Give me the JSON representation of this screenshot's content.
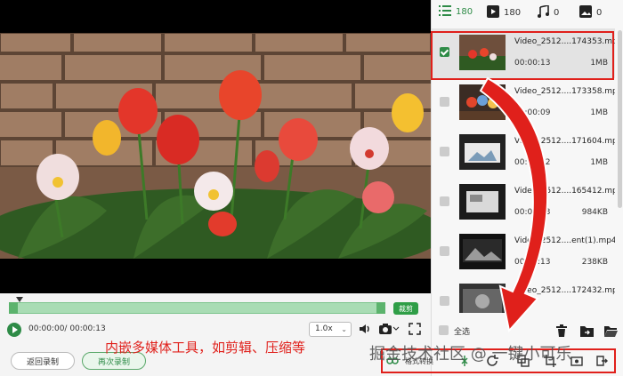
{
  "stats": {
    "all_count": "180",
    "video_count": "180",
    "audio_count": "0",
    "image_count": "0"
  },
  "player": {
    "time": "00:00:00/ 00:00:13",
    "speed": "1.0x",
    "cut_label": "裁剪"
  },
  "buttons": {
    "back": "返回录制",
    "again": "再次录制"
  },
  "annotation": "内嵌多媒体工具，如剪辑、压缩等",
  "watermark": "掘金技术社区 @ 一键小可乐",
  "list": {
    "items": [
      {
        "name": "Video_2512....174353.mp4",
        "duration": "00:00:13",
        "size": "1MB",
        "selected": true
      },
      {
        "name": "Video_2512....173358.mp4",
        "duration": "00:00:09",
        "size": "1MB",
        "selected": false
      },
      {
        "name": "Video_2512....171604.mp4",
        "duration": "00:00:12",
        "size": "1MB",
        "selected": false
      },
      {
        "name": "Video_2512....165412.mp4",
        "duration": "00:00:13",
        "size": "984KB",
        "selected": false
      },
      {
        "name": "Video_2512....ent(1).mp4",
        "duration": "00:00:13",
        "size": "238KB",
        "selected": false
      },
      {
        "name": "Video_2512....172432.mp4",
        "duration": "",
        "size": "",
        "selected": false
      }
    ],
    "select_all": "全选"
  },
  "toolbar": {
    "label": "格式转换"
  },
  "colors": {
    "accent": "#2e8b47",
    "highlight": "#e0201b"
  }
}
